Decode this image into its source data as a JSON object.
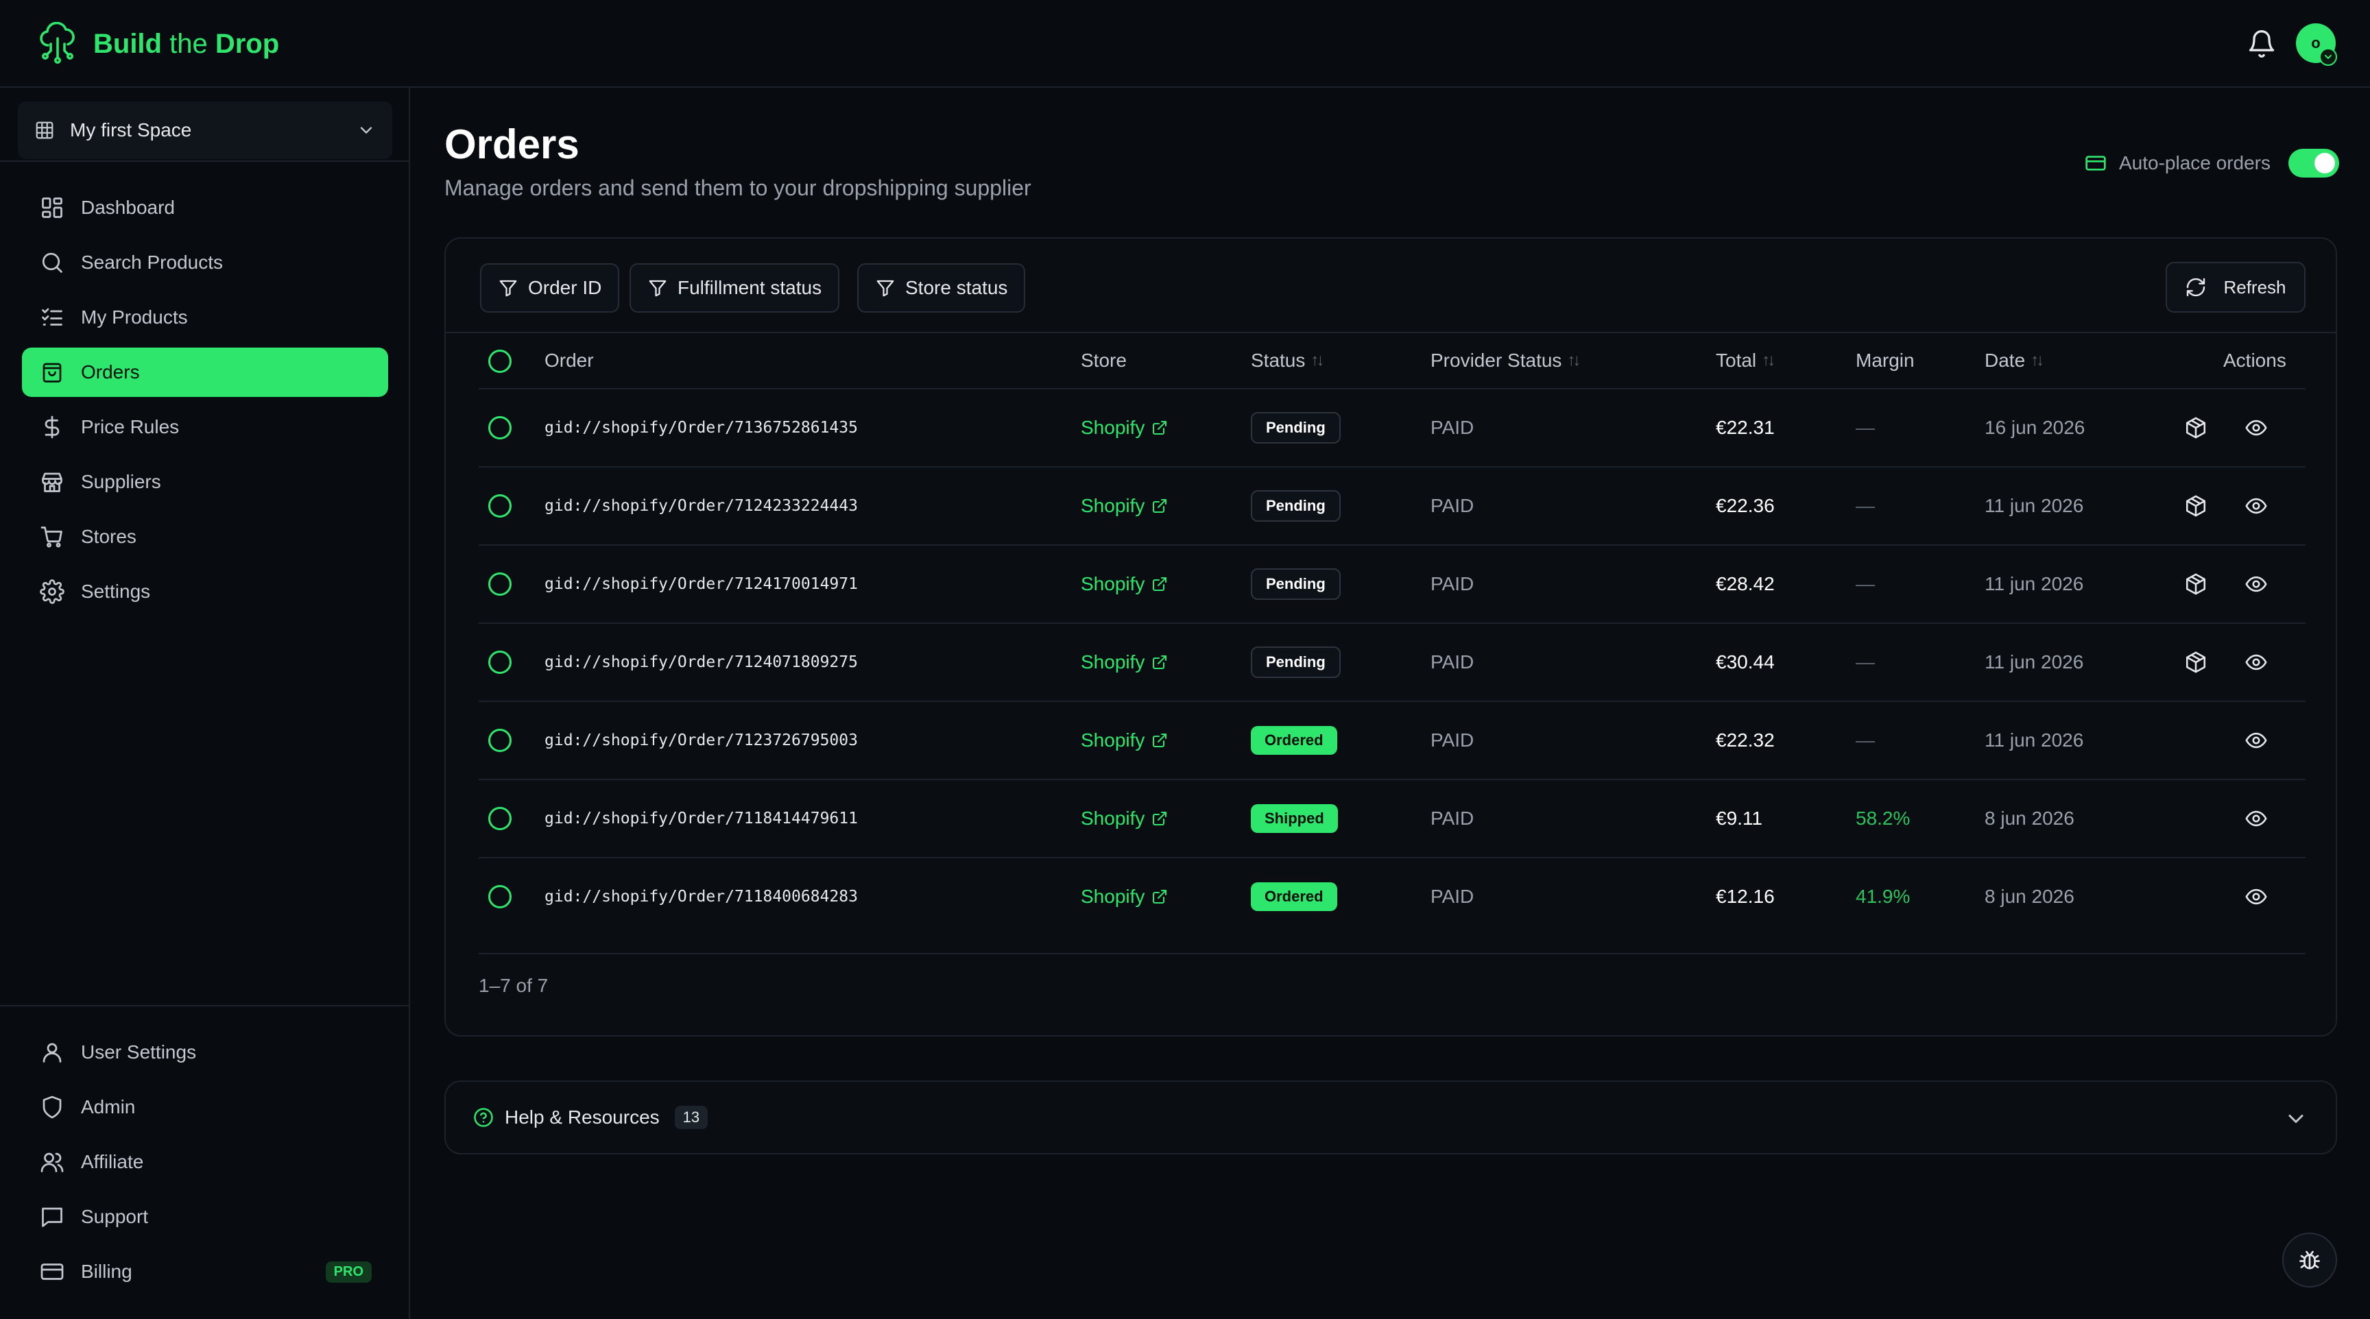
{
  "brand": {
    "name_bold_1": "Build",
    "name_thin": " the ",
    "name_bold_2": "Drop",
    "accent": "#2ee66b"
  },
  "header": {
    "avatar_initial": "o"
  },
  "sidebar": {
    "space_name": "My first Space",
    "items": [
      {
        "label": "Dashboard",
        "icon": "dashboard-icon"
      },
      {
        "label": "Search Products",
        "icon": "search-icon"
      },
      {
        "label": "My Products",
        "icon": "list-check-icon"
      },
      {
        "label": "Orders",
        "icon": "shopping-bag-icon",
        "active": true
      },
      {
        "label": "Price Rules",
        "icon": "dollar-icon"
      },
      {
        "label": "Suppliers",
        "icon": "store-icon"
      },
      {
        "label": "Stores",
        "icon": "cart-icon"
      },
      {
        "label": "Settings",
        "icon": "gear-icon"
      }
    ],
    "bottom_items": [
      {
        "label": "User Settings",
        "icon": "user-icon"
      },
      {
        "label": "Admin",
        "icon": "shield-icon"
      },
      {
        "label": "Affiliate",
        "icon": "users-icon"
      },
      {
        "label": "Support",
        "icon": "chat-icon"
      },
      {
        "label": "Billing",
        "icon": "credit-card-icon",
        "badge": "PRO"
      }
    ]
  },
  "page": {
    "title": "Orders",
    "subtitle": "Manage orders and send them to your dropshipping supplier",
    "auto_place_label": "Auto-place orders",
    "auto_place_enabled": true
  },
  "filters": [
    "Order ID",
    "Fulfillment status",
    "Store status"
  ],
  "refresh_label": "Refresh",
  "table": {
    "columns": [
      "Order",
      "Store",
      "Status",
      "Provider Status",
      "Total",
      "Margin",
      "Date",
      "Actions"
    ],
    "rows": [
      {
        "order": "gid://shopify/Order/7136752861435",
        "store": "Shopify",
        "status": "Pending",
        "provider": "PAID",
        "total": "€22.31",
        "margin": "—",
        "date": "16 jun 2026"
      },
      {
        "order": "gid://shopify/Order/7124233224443",
        "store": "Shopify",
        "status": "Pending",
        "provider": "PAID",
        "total": "€22.36",
        "margin": "—",
        "date": "11 jun 2026"
      },
      {
        "order": "gid://shopify/Order/7124170014971",
        "store": "Shopify",
        "status": "Pending",
        "provider": "PAID",
        "total": "€28.42",
        "margin": "—",
        "date": "11 jun 2026"
      },
      {
        "order": "gid://shopify/Order/7124071809275",
        "store": "Shopify",
        "status": "Pending",
        "provider": "PAID",
        "total": "€30.44",
        "margin": "—",
        "date": "11 jun 2026"
      },
      {
        "order": "gid://shopify/Order/7123726795003",
        "store": "Shopify",
        "status": "Ordered",
        "provider": "PAID",
        "total": "€22.32",
        "margin": "—",
        "date": "11 jun 2026"
      },
      {
        "order": "gid://shopify/Order/7118414479611",
        "store": "Shopify",
        "status": "Shipped",
        "provider": "PAID",
        "total": "€9.11",
        "margin": "58.2%",
        "date": "8 jun 2026"
      },
      {
        "order": "gid://shopify/Order/7118400684283",
        "store": "Shopify",
        "status": "Ordered",
        "provider": "PAID",
        "total": "€12.16",
        "margin": "41.9%",
        "date": "8 jun 2026"
      }
    ],
    "pagination": "1–7 of 7"
  },
  "help": {
    "label": "Help & Resources",
    "count": "13"
  }
}
